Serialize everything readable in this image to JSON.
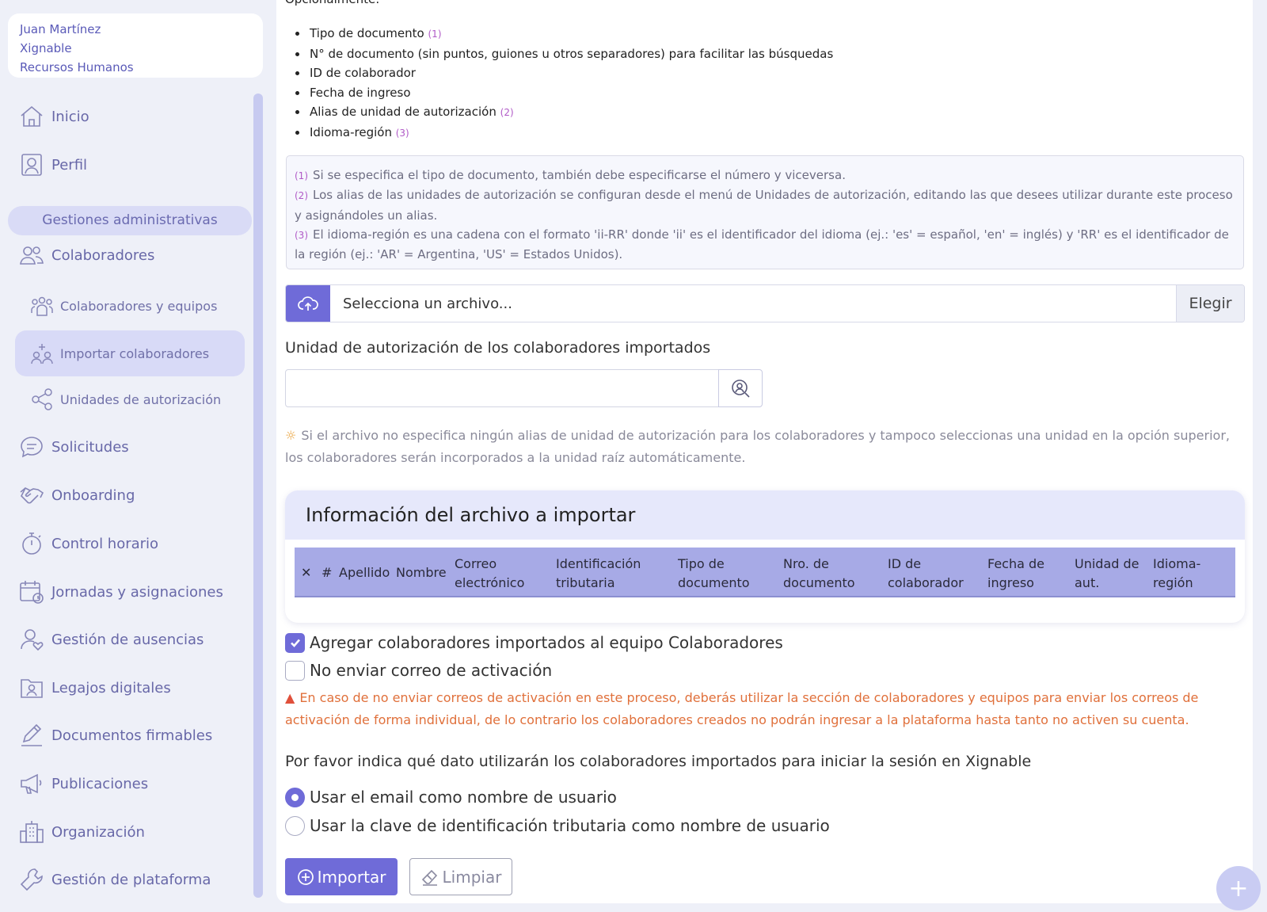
{
  "user": {
    "name": "Juan Martínez",
    "company": "Xignable",
    "department": "Recursos Humanos"
  },
  "nav": {
    "inicio": "Inicio",
    "perfil": "Perfil",
    "section": "Gestiones administrativas",
    "colaboradores": "Colaboradores",
    "sub_equipos": "Colaboradores y equipos",
    "sub_importar": "Importar colaboradores",
    "sub_unidades": "Unidades de autorización",
    "solicitudes": "Solicitudes",
    "onboarding": "Onboarding",
    "control": "Control horario",
    "jornadas": "Jornadas y asignaciones",
    "ausencias": "Gestión de ausencias",
    "legajos": "Legajos digitales",
    "documentos": "Documentos firmables",
    "publicaciones": "Publicaciones",
    "organizacion": "Organización",
    "plataforma": "Gestión de plataforma"
  },
  "main": {
    "top_cut": "Opcionalmente:",
    "bullets": {
      "b1": "Tipo de documento",
      "b1_mark": "(1)",
      "b2": "N° de documento (sin puntos, guiones u otros separadores) para facilitar las búsquedas",
      "b3": "ID de colaborador",
      "b4": "Fecha de ingreso",
      "b5": "Alias de unidad de autorización",
      "b5_mark": "(2)",
      "b6": "Idioma-región",
      "b6_mark": "(3)"
    },
    "notes": {
      "n1_mark": "(1)",
      "n1": "Si se especifica el tipo de documento, también debe especificarse el número y viceversa.",
      "n2_mark": "(2)",
      "n2": "Los alias de las unidades de autorización se configuran desde el menú de Unidades de autorización, editando las que desees utilizar durante este proceso y asignándoles un alias.",
      "n3_mark": "(3)",
      "n3": "El idioma-región es una cadena con el formato 'ii-RR' donde 'ii' es el identificador del idioma (ej.: 'es' = español, 'en' = inglés) y 'RR' es el identificador de la región (ej.: 'AR' = Argentina, 'US' = Estados Unidos)."
    },
    "file": {
      "placeholder": "Selecciona un archivo...",
      "button": "Elegir"
    },
    "unit_label": "Unidad de autorización de los colaboradores importados",
    "unit_hint": "Si el archivo no especifica ningún alias de unidad de autorización para los colaboradores y tampoco seleccionas una unidad en la opción superior, los colaboradores serán incorporados a la unidad raíz automáticamente.",
    "info_title": "Información del archivo a importar",
    "columns": {
      "x": "✕",
      "num": "#",
      "apellido": "Apellido",
      "nombre": "Nombre",
      "correo1": "Correo",
      "correo2": "electrónico",
      "ident1": "Identificación",
      "ident2": "tributaria",
      "tipo1": "Tipo de",
      "tipo2": "documento",
      "nro1": "Nro. de",
      "nro2": "documento",
      "id1": "ID de",
      "id2": "colaborador",
      "fecha1": "Fecha de",
      "fecha2": "ingreso",
      "unidad1": "Unidad de",
      "unidad2": "aut.",
      "idioma1": "Idioma-",
      "idioma2": "región"
    },
    "chk_agregar": "Agregar colaboradores importados al equipo Colaboradores",
    "chk_no_enviar": "No enviar correo de activación",
    "warning": "En caso de no enviar correos de activación en este proceso, deberás utilizar la sección de colaboradores y equipos para enviar los correos de activación de forma individual, de lo contrario los colaboradores creados no podrán ingresar a la plataforma hasta tanto no activen su cuenta.",
    "login_question": "Por favor indica qué dato utilizarán los colaboradores importados para iniciar la sesión en Xignable",
    "radio_email": "Usar el email como nombre de usuario",
    "radio_clave": "Usar la clave de identificación tributaria como nombre de usuario",
    "btn_import": "Importar",
    "btn_clear": "Limpiar"
  },
  "fab": "+",
  "colors": {
    "accent": "#6f6bd8",
    "warning": "#e0703b",
    "sidebar_active": "#d8daf7"
  }
}
